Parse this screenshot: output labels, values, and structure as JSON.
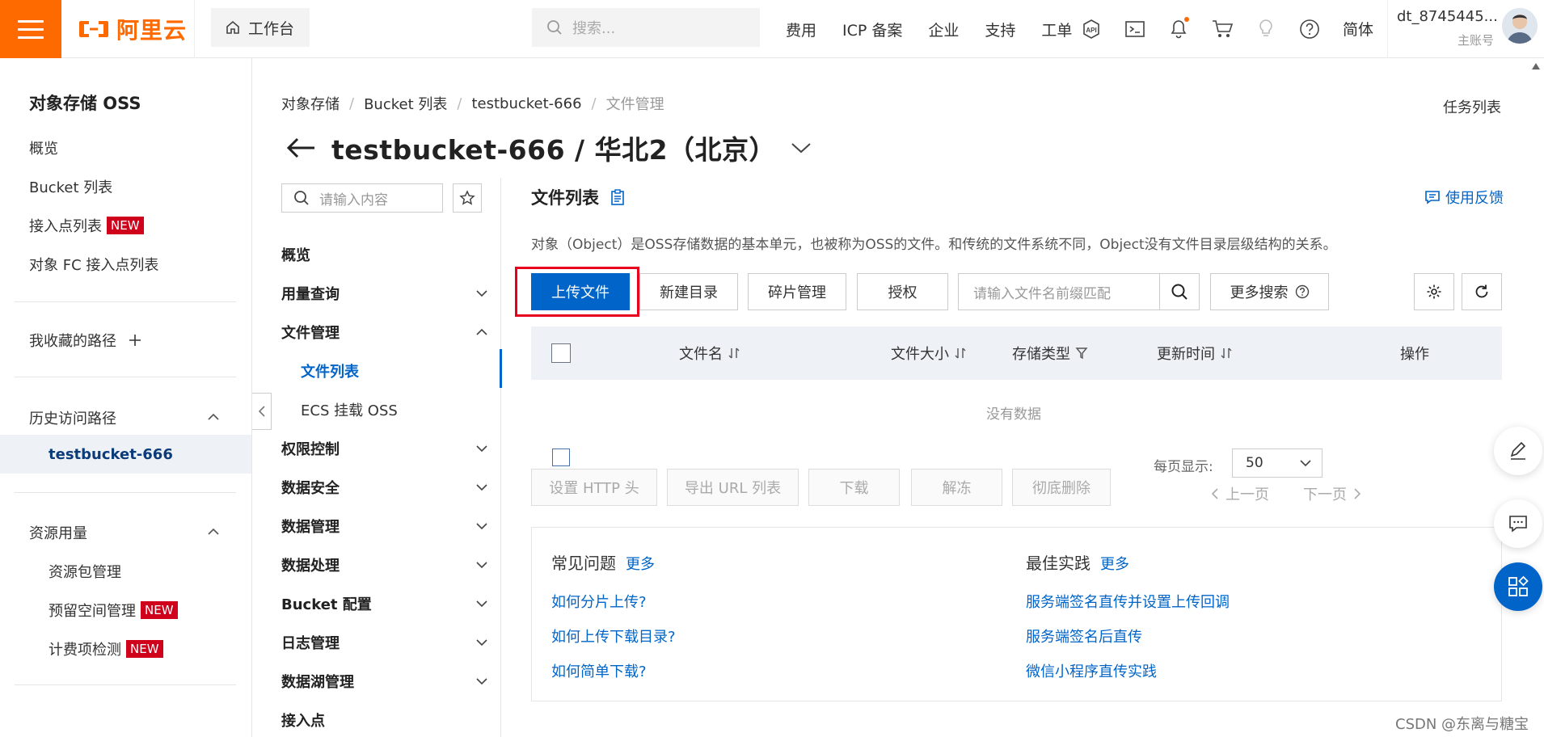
{
  "topbar": {
    "brand": "阿里云",
    "workbench": "工作台",
    "search_placeholder": "搜索...",
    "links": [
      "费用",
      "ICP 备案",
      "企业",
      "支持",
      "工单"
    ],
    "icons": [
      "api-icon",
      "terminal-icon",
      "bell-icon",
      "cart-icon",
      "lightbulb-icon",
      "help-icon"
    ],
    "lang": "简体",
    "username": "dt_8745445...",
    "role": "主账号",
    "accent": "#ff6a00"
  },
  "sidebar": {
    "title": "对象存储 OSS",
    "items": [
      "概览",
      "Bucket 列表",
      "接入点列表",
      "对象 FC 接入点列表"
    ],
    "new_badge": "NEW",
    "favorites": "我收藏的路径",
    "history": "历史访问路径",
    "history_item": "testbucket-666",
    "resources": "资源用量",
    "resource_items": [
      "资源包管理",
      "预留空间管理",
      "计费项检测"
    ]
  },
  "breadcrumb": [
    "对象存储",
    "Bucket 列表",
    "testbucket-666",
    "文件管理"
  ],
  "task_list": "任务列表",
  "page_title": "testbucket-666 / 华北2（北京）",
  "midnav": {
    "search_placeholder": "请输入内容",
    "items": [
      "概览",
      "用量查询",
      "文件管理",
      "权限控制",
      "数据安全",
      "数据管理",
      "数据处理",
      "Bucket 配置",
      "日志管理",
      "数据湖管理",
      "接入点"
    ],
    "sub_items": [
      "文件列表",
      "ECS 挂载 OSS"
    ]
  },
  "main": {
    "title": "文件列表",
    "feedback": "使用反馈",
    "description": "对象（Object）是OSS存储数据的基本单元，也被称为OSS的文件。和传统的文件系统不同，Object没有文件目录层级结构的关系。",
    "buttons": {
      "upload": "上传文件",
      "new_dir": "新建目录",
      "fragments": "碎片管理",
      "authorize": "授权",
      "more_search": "更多搜索"
    },
    "prefix_placeholder": "请输入文件名前缀匹配",
    "columns": [
      "文件名",
      "文件大小",
      "存储类型",
      "更新时间",
      "操作"
    ],
    "no_data": "没有数据",
    "bulk_actions": [
      "设置 HTTP 头",
      "导出 URL 列表",
      "下载",
      "解冻",
      "彻底删除"
    ],
    "per_page_label": "每页显示:",
    "per_page_value": "50",
    "prev": "上一页",
    "next": "下一页",
    "primary_color": "#0064c8"
  },
  "faq": {
    "left_title": "常见问题",
    "right_title": "最佳实践",
    "more": "更多",
    "left_links": [
      "如何分片上传?",
      "如何上传下载目录?",
      "如何简单下载?"
    ],
    "right_links": [
      "服务端签名直传并设置上传回调",
      "服务端签名后直传",
      "微信小程序直传实践"
    ]
  },
  "watermark": "CSDN @东离与糖宝"
}
